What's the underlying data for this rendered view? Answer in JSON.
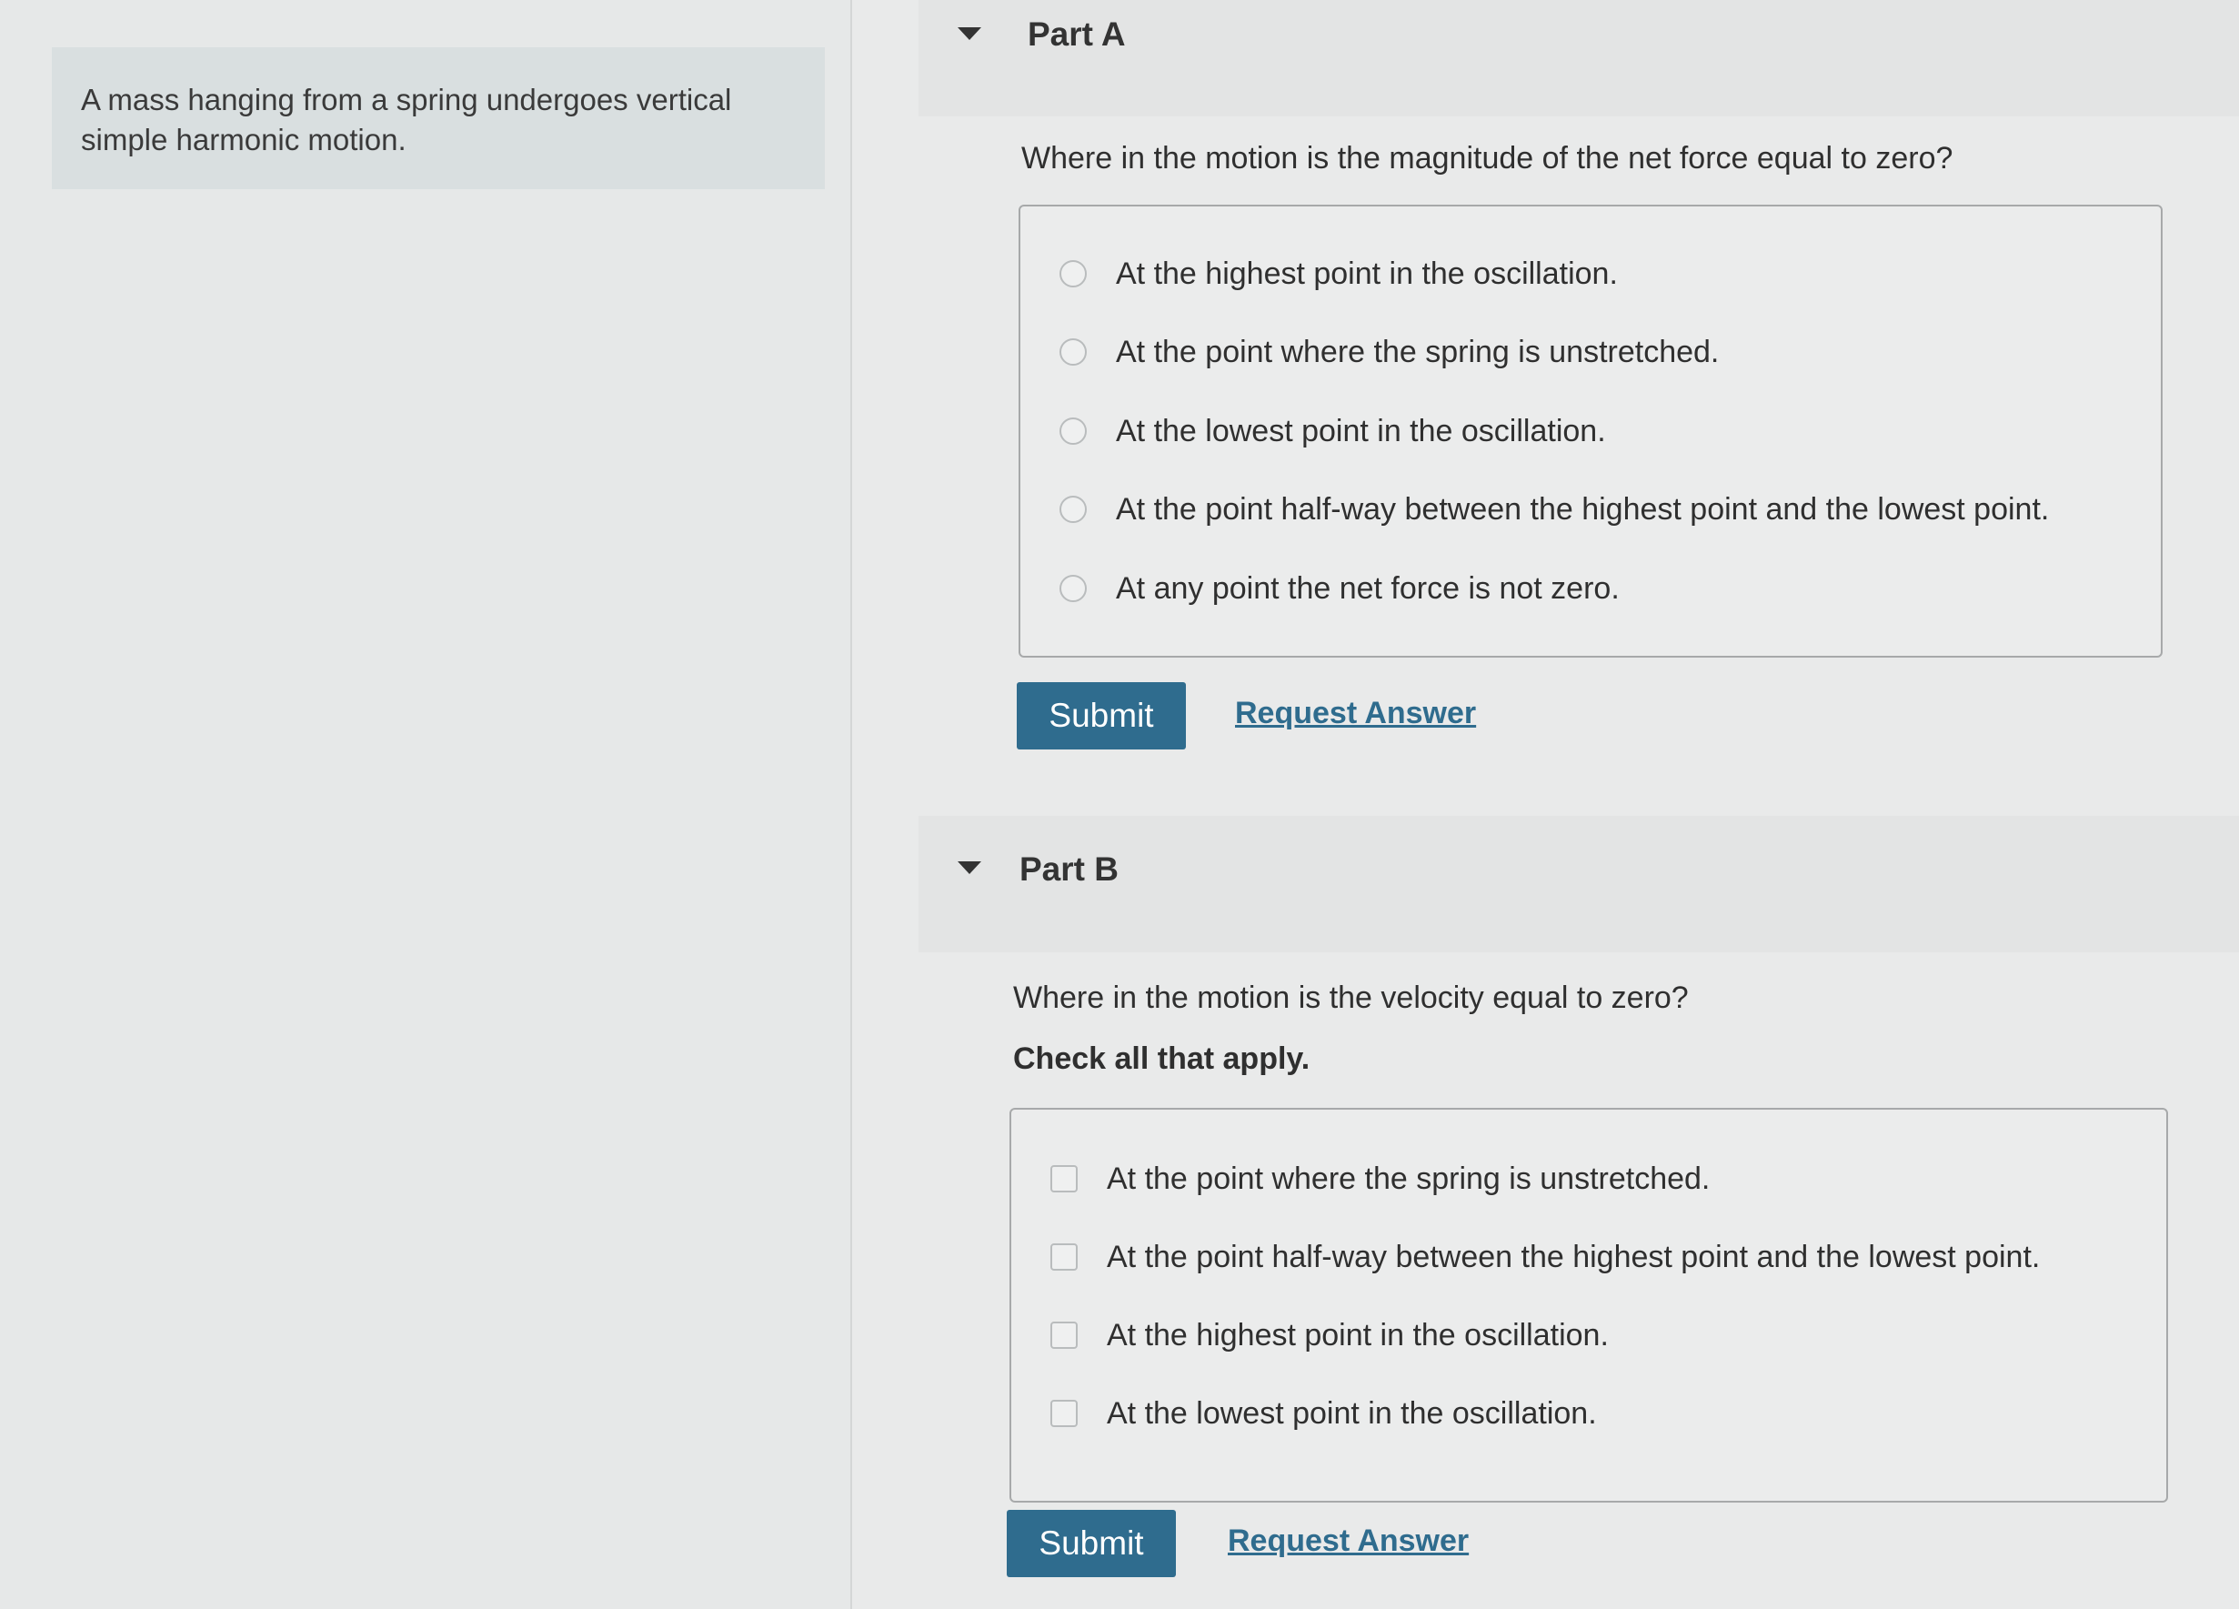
{
  "intro": {
    "text": "A mass hanging from a spring undergoes vertical simple harmonic motion."
  },
  "part_a": {
    "title": "Part A",
    "question": "Where in the motion is the magnitude of the net force equal to zero?",
    "options": [
      "At the highest point in the oscillation.",
      "At the point where the spring is unstretched.",
      "At the lowest point in the oscillation.",
      "At the point half-way between the highest point and the lowest point.",
      "At any point the net force is not zero."
    ],
    "submit_label": "Submit",
    "request_label": "Request Answer"
  },
  "part_b": {
    "title": "Part B",
    "question": "Where in the motion is the velocity equal to zero?",
    "instruction": "Check all that apply.",
    "options": [
      "At the point where the spring is unstretched.",
      "At the point half-way between the highest point and the lowest point.",
      "At the highest point in the oscillation.",
      "At the lowest point in the oscillation."
    ],
    "submit_label": "Submit",
    "request_label": "Request Answer"
  },
  "colors": {
    "accent": "#2f6c8e",
    "background": "#e9eaea",
    "intro_box": "#d9dfe0"
  }
}
